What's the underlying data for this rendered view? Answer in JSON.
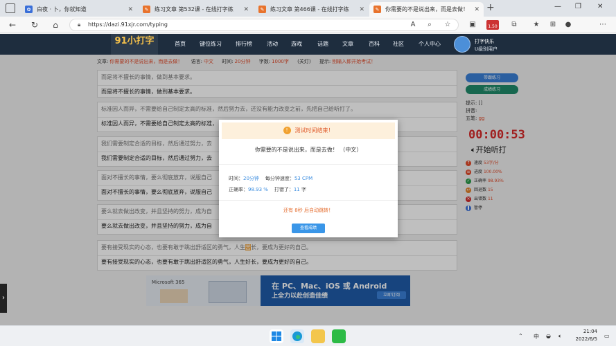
{
  "browser": {
    "tabs": [
      {
        "title": "白夜 · 卜，你就知道",
        "color": "#3a6fd8"
      },
      {
        "title": "练习文章 第532课 - 在线打字练",
        "color": "#e8732d"
      },
      {
        "title": "练习文章 第466课 - 在线打字练",
        "color": "#e8732d"
      },
      {
        "title": "你需要的不是说出来，而是去做！",
        "color": "#e8732d"
      }
    ],
    "new_tab": "+",
    "url": "https://dazi.91xjr.com/typing",
    "badge": "1.50"
  },
  "site": {
    "logo": "91小打字",
    "nav": [
      "首页",
      "键位练习",
      "排行榜",
      "活动",
      "游戏",
      "话题",
      "文章",
      "百科",
      "社区",
      "个人中心"
    ],
    "user": {
      "name": "打字快乐",
      "level": "U级别用户"
    }
  },
  "infobar": {
    "article_label": "文章:",
    "article_title": "你需要的不是说出来，而是去做！",
    "language_label": "语言:",
    "language": "中文",
    "time_label": "时间:",
    "time": "20分钟",
    "count_label": "字数:",
    "count": "1000字",
    "status": "(关灯)",
    "tip_label": "提示:",
    "tip": "别输入即开始考试！"
  },
  "pairs": [
    {
      "source": "而是将不擅长的事情，做到基本要求。",
      "typed": "而是将不擅长的事情，做到基本要求。"
    },
    {
      "source": "标准因人而异，不需要给自己制定太高的标准，然后努力去，还没有能力改变之前，先把自己给听打了。",
      "typed": "标准因人而异，不需要给自己制定太高的标准，"
    },
    {
      "source": "我们需要制定合适的目标，然后通过努力，去",
      "typed": "我们需要制定合适的目标，然后通过努力，去"
    },
    {
      "source": "面对不擅长的事情，要么彻底放弃，说服自己",
      "typed": "面对不擅长的事情，要么彻底放弃，说服自己"
    },
    {
      "source": "要么就去做出改变，并且坚持的努力，成为自",
      "typed": "要么就去做出改变，并且坚持的努力，成为自"
    },
    {
      "source_pre": "要有接受现实的心态，也要有敢于跳出舒适区的勇气，人生",
      "source_hl": "苦",
      "source_post": "长，要成为更好的自己。",
      "typed": "要有接受现实的心态，也要有敢于跳出舒适区的勇气，人生好长，要成为更好的自己。"
    }
  ],
  "right_panel": {
    "btn1": "带跟练习",
    "btn2": "成绩练习",
    "tip_label": "提示: [",
    "tip_label_end": "]",
    "pinyin_label": "拼音:",
    "wubi_label": "五笔:",
    "wubi_value": "gg",
    "timer": "00:00:53",
    "listen": "开始听打",
    "stats": [
      {
        "label": "速度",
        "value": "53字/分",
        "color": "#e04a2a"
      },
      {
        "label": "进度",
        "value": "100.00%",
        "color": "#e04a2a"
      },
      {
        "label": "正确率",
        "value": "98.93%",
        "color": "#2a9a4a"
      },
      {
        "label": "回退数",
        "value": "15",
        "color": "#e0802a"
      },
      {
        "label": "出错数",
        "value": "11",
        "color": "#d02a2a"
      },
      {
        "label": "暂停",
        "value": "",
        "color": "#3a6fd8"
      }
    ]
  },
  "ad": {
    "brand": "Microsoft 365",
    "line1": "在 PC、Mac、iOS 或 Android",
    "line2": "上全力以赴创造佳绩",
    "button": "立即订阅"
  },
  "modal": {
    "header": "测试时间结束！",
    "sentence": "你需要的不是说出来，而是去做！ （中文）",
    "time_label": "时间：",
    "time_value": "20分钟",
    "speed_label": "每分钟速度：",
    "speed_value": "53 CPM",
    "accuracy_label": "正确率：",
    "accuracy_value": "98.93 %",
    "typed_label": "打错了：",
    "typed_value": "11",
    "typed_unit": "字",
    "auto_msg": "还有 8秒 后自动跳转！",
    "button": "查看成绩"
  },
  "taskbar": {
    "time": "21:04",
    "date": "2022/6/5",
    "lang": "中"
  }
}
